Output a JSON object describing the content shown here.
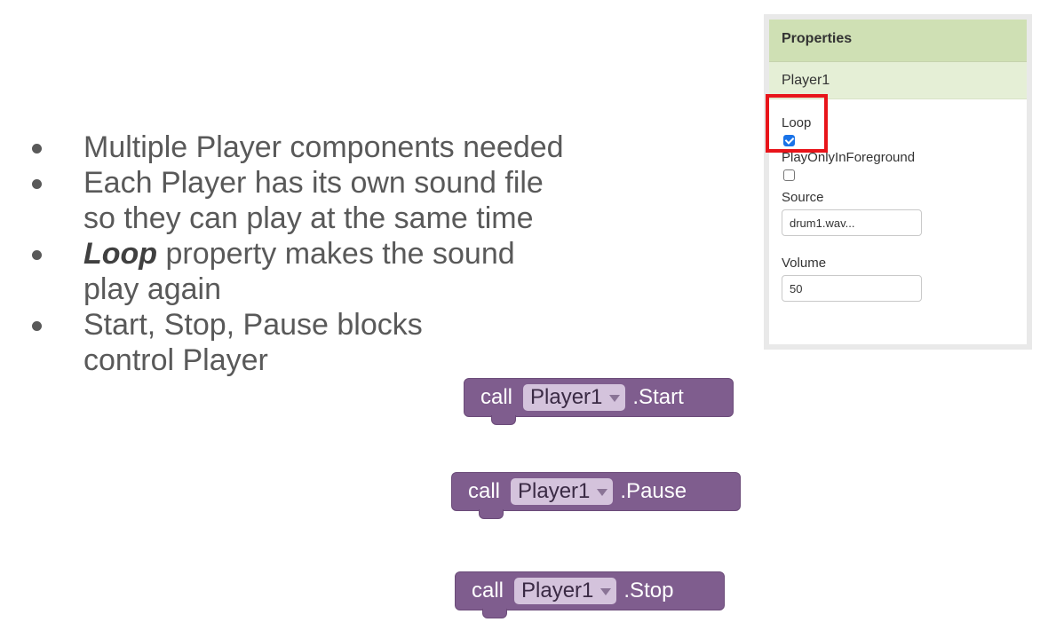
{
  "bullets": [
    {
      "lines": [
        "Multiple Player components needed"
      ]
    },
    {
      "lines": [
        "Each Player has its own sound file",
        "so they can play at the same time"
      ]
    },
    {
      "emphasis": "Loop",
      "lines": [
        " property makes the sound",
        "play again"
      ]
    },
    {
      "lines": [
        "Start, Stop, Pause blocks",
        "control Player"
      ]
    }
  ],
  "properties": {
    "header": "Properties",
    "component": "Player1",
    "loop": {
      "label": "Loop",
      "checked": true
    },
    "play_only_in_foreground": {
      "label": "PlayOnlyInForeground",
      "checked": false
    },
    "source": {
      "label": "Source",
      "value": "drum1.wav..."
    },
    "volume": {
      "label": "Volume",
      "value": "50"
    }
  },
  "blocks": [
    {
      "keyword": "call",
      "component": "Player1",
      "method": ".Start"
    },
    {
      "keyword": "call",
      "component": "Player1",
      "method": ".Pause"
    },
    {
      "keyword": "call",
      "component": "Player1",
      "method": ".Stop"
    }
  ],
  "colors": {
    "block_fill": "#7f5d8e",
    "panel_header": "#cfe0b4",
    "highlight": "#e8141a",
    "checkbox_checked": "#1a73e8",
    "bullet_text": "#595959"
  }
}
